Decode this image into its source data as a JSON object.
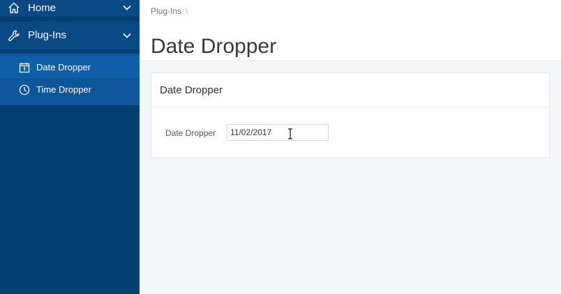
{
  "sidebar": {
    "items": [
      {
        "label": "Home",
        "icon": "home-icon"
      },
      {
        "label": "Plug-Ins",
        "icon": "wrench-icon"
      }
    ],
    "subitems": [
      {
        "label": "Date Dropper",
        "icon": "calendar-icon",
        "active": true
      },
      {
        "label": "Time Dropper",
        "icon": "clock-icon"
      }
    ],
    "colors": {
      "background": "#053f72",
      "item_background": "#0a4a84",
      "submenu_background": "#0c5699"
    }
  },
  "header": {
    "breadcrumb": "Plug-Ins",
    "breadcrumb_separator": "\\",
    "title": "Date Dropper"
  },
  "region": {
    "title": "Date Dropper",
    "field": {
      "label": "Date Dropper",
      "value": "11/02/2017"
    }
  }
}
